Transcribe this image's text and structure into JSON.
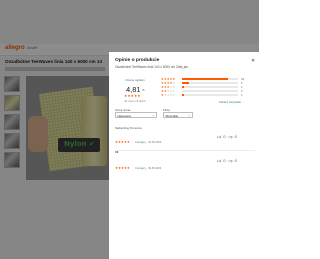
{
  "background": {
    "logo": "allegro",
    "logo_sub": "Smart!",
    "product_title": "Oszalbótne TeeWaves linia 140 x 6000 cm 13"
  },
  "modal": {
    "title": "Opinie o produkcie",
    "close_icon": "close-icon",
    "subtitle": "Oszalbótne TeeWaves linia 140 x 6000 cm Zółty jas"
  },
  "summary": {
    "heading": "Ocena ogółem",
    "value": "4,81",
    "value_suffix": "/5",
    "stars": "★★★★★",
    "count": "51 ocen i 8 opinii"
  },
  "distribution": [
    {
      "stars": 5,
      "fill": 0.82,
      "count": "43"
    },
    {
      "stars": 4,
      "fill": 0.12,
      "count": "6"
    },
    {
      "stars": 3,
      "fill": 0.03,
      "count": "1"
    },
    {
      "stars": 2,
      "fill": 0.0,
      "count": "0"
    },
    {
      "stars": 1,
      "fill": 0.03,
      "count": "1"
    }
  ],
  "links": {
    "all_reviews": "Zobacz wszystkie"
  },
  "sort": {
    "label": "Sortuj opinie",
    "value": "Najnowsze",
    "chevron_icon": "chevron-down-icon"
  },
  "filter": {
    "label": "Filtruj",
    "value": "Wszystkie",
    "chevron_icon": "chevron-down-icon"
  },
  "reviews": [
    {
      "label": "Najbardziej Pomocna",
      "stars": "★★★★★",
      "meta": "Kupujący · 24.06.2023",
      "text": "ok",
      "likes": "0",
      "dislikes": "0"
    },
    {
      "label": "",
      "stars": "★★★★★",
      "meta": "Kupujący · 09.05.2023",
      "text": "",
      "likes": "0",
      "dislikes": "0"
    }
  ],
  "colors": {
    "accent": "#ff5a00",
    "link": "#2a7a70",
    "overlay": "rgba(0,0,0,0.45)"
  }
}
